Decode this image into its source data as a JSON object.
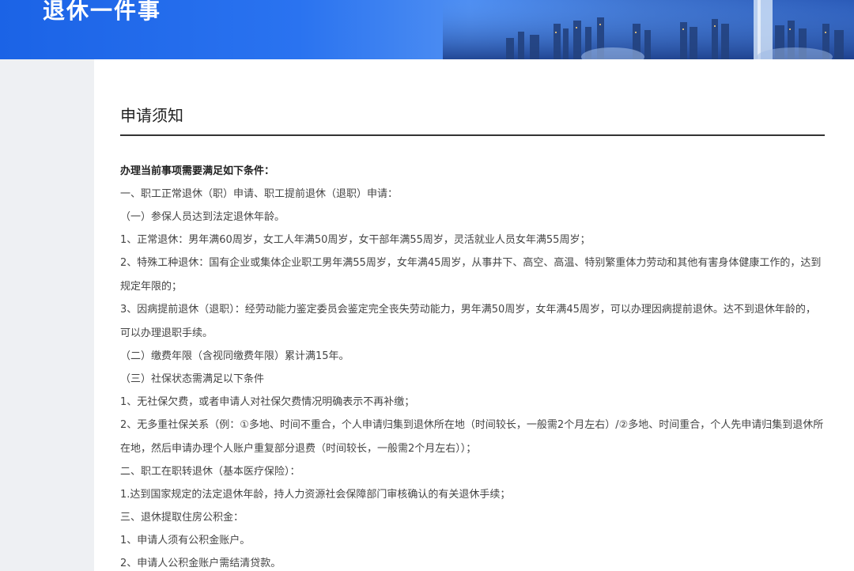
{
  "banner": {
    "title": "退休一件事"
  },
  "notice": {
    "title": "申请须知",
    "lines": [
      "办理当前事项需要满足如下条件：",
      "一、职工正常退休（职）申请、职工提前退休（退职）申请：",
      "（一）参保人员达到法定退休年龄。",
      "1、正常退休：男年满60周岁，女工人年满50周岁，女干部年满55周岁，灵活就业人员女年满55周岁；",
      "2、特殊工种退休：国有企业或集体企业职工男年满55周岁，女年满45周岁，从事井下、高空、高温、特别繁重体力劳动和其他有害身体健康工作的，达到规定年限的；",
      "3、因病提前退休（退职）：经劳动能力鉴定委员会鉴定完全丧失劳动能力，男年满50周岁，女年满45周岁，可以办理因病提前退休。达不到退休年龄的，可以办理退职手续。",
      "（二）缴费年限（含视同缴费年限）累计满15年。",
      "（三）社保状态需满足以下条件",
      "1、无社保欠费，或者申请人对社保欠费情况明确表示不再补缴；",
      "2、无多重社保关系（例：①多地、时间不重合，个人申请归集到退休所在地（时间较长，一般需2个月左右）/②多地、时间重合，个人先申请归集到退休所在地，然后申请办理个人账户重复部分退费（时间较长，一般需2个月左右））；",
      "二、职工在职转退休（基本医疗保险）：",
      "1.达到国家规定的法定退休年龄，持人力资源社会保障部门审核确认的有关退休手续；",
      "三、退休提取住房公积金：",
      "1、申请人须有公积金账户。",
      "2、申请人公积金账户需结清贷款。"
    ]
  }
}
